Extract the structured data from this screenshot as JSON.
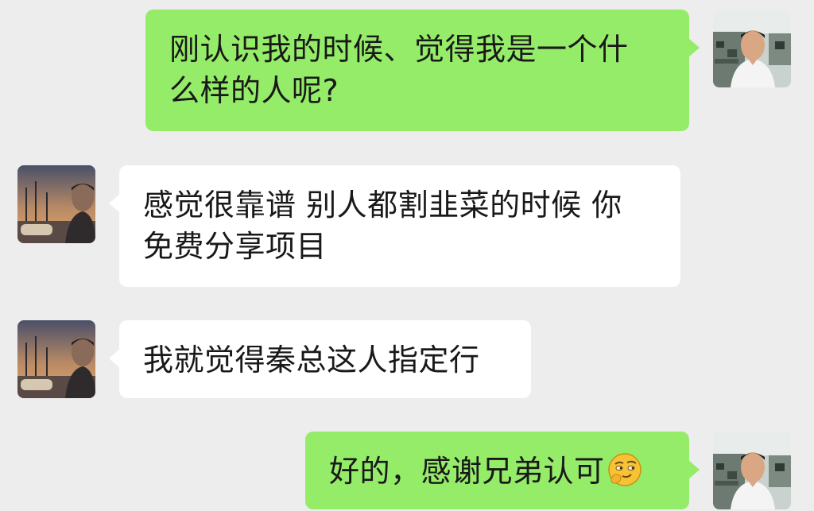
{
  "messages": [
    {
      "direction": "sent",
      "lines": [
        "刚认识我的时候、觉得我是一个什",
        "么样的人呢?"
      ]
    },
    {
      "direction": "received",
      "lines": [
        "感觉很靠谱 别人都割韭菜的时候 你",
        "免费分享项目"
      ]
    },
    {
      "direction": "received",
      "lines": [
        "我就觉得秦总这人指定行"
      ]
    },
    {
      "direction": "sent",
      "lines": [
        "好的，感谢兄弟认可"
      ],
      "trailing_emoji": "smirk-hand-on-chin-emoji"
    }
  ],
  "colors": {
    "background": "#ededed",
    "sent_bubble": "#95ec69",
    "received_bubble": "#ffffff",
    "text": "#191919"
  }
}
